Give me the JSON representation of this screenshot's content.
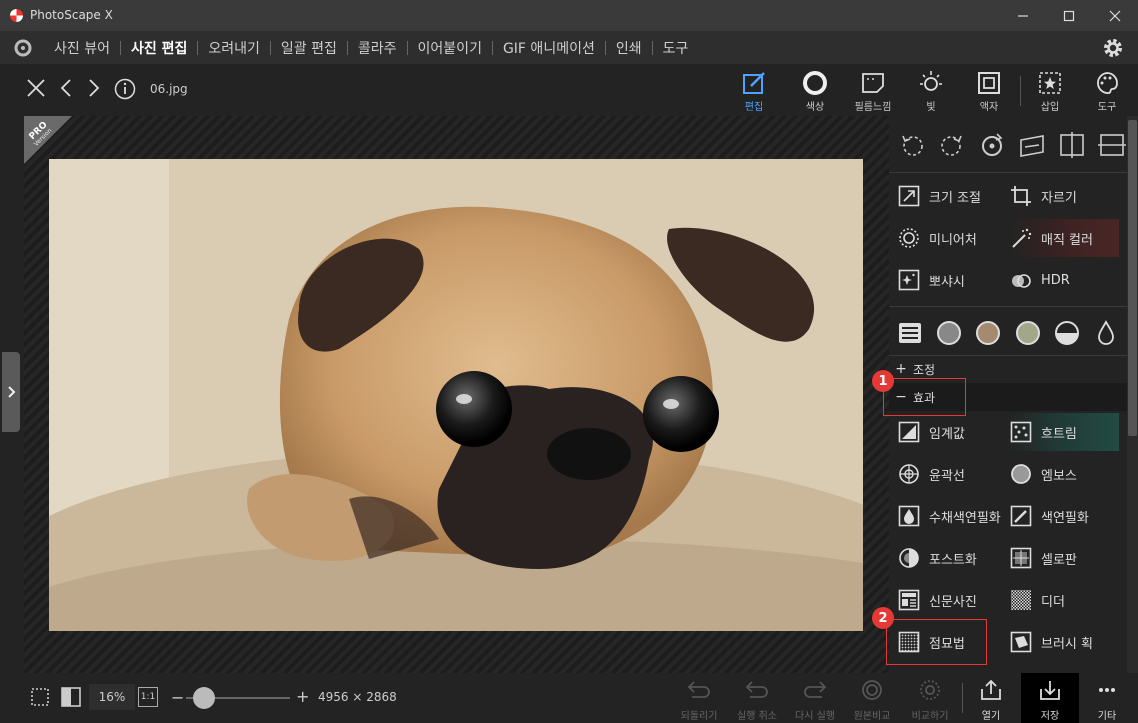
{
  "window": {
    "title": "PhotoScape X"
  },
  "menu": {
    "items": [
      {
        "label": "사진 뷰어",
        "active": false
      },
      {
        "label": "사진 편집",
        "active": true
      },
      {
        "label": "오려내기",
        "active": false
      },
      {
        "label": "일괄 편집",
        "active": false
      },
      {
        "label": "콜라주",
        "active": false
      },
      {
        "label": "이어붙이기",
        "active": false
      },
      {
        "label": "GIF 애니메이션",
        "active": false
      },
      {
        "label": "인쇄",
        "active": false
      },
      {
        "label": "도구",
        "active": false
      }
    ]
  },
  "toolbar": {
    "filename": "06.jpg",
    "tools": [
      {
        "label": "편집",
        "icon": "edit-icon",
        "active": true
      },
      {
        "label": "색상",
        "icon": "color-circle-icon"
      },
      {
        "label": "필름느낌",
        "icon": "film-icon"
      },
      {
        "label": "빛",
        "icon": "sun-icon"
      },
      {
        "label": "액자",
        "icon": "frame-icon"
      },
      {
        "label": "삽입",
        "icon": "insert-icon"
      },
      {
        "label": "도구",
        "icon": "palette-icon"
      }
    ]
  },
  "canvas": {
    "badge_main": "PRO",
    "badge_sub": "Version"
  },
  "panel": {
    "top_buttons": [
      {
        "label": "크기 조절",
        "icon": "resize-icon"
      },
      {
        "label": "자르기",
        "icon": "crop-icon"
      },
      {
        "label": "미니어처",
        "icon": "miniature-icon"
      },
      {
        "label": "매직 컬러",
        "icon": "magic-wand-icon"
      },
      {
        "label": "뽀샤시",
        "icon": "sparkle-icon"
      },
      {
        "label": "HDR",
        "icon": "hdr-icon"
      }
    ],
    "section_adjust": {
      "sign": "+",
      "label": "조정"
    },
    "section_effect": {
      "sign": "−",
      "label": "효과"
    },
    "effect_buttons": [
      {
        "label": "임계값",
        "icon": "threshold-icon"
      },
      {
        "label": "흐트림",
        "icon": "scatter-icon"
      },
      {
        "label": "윤곽선",
        "icon": "outline-icon"
      },
      {
        "label": "엠보스",
        "icon": "emboss-icon"
      },
      {
        "label": "수채색연필화",
        "icon": "watercolor-icon"
      },
      {
        "label": "색연필화",
        "icon": "pencil-icon"
      },
      {
        "label": "포스트화",
        "icon": "posterize-icon"
      },
      {
        "label": "셀로판",
        "icon": "cellophane-icon"
      },
      {
        "label": "신문사진",
        "icon": "newspaper-icon"
      },
      {
        "label": "디더",
        "icon": "dither-icon"
      },
      {
        "label": "점묘법",
        "icon": "pointillism-icon"
      },
      {
        "label": "브러시 획",
        "icon": "brush-stroke-icon"
      }
    ],
    "callouts": [
      "1",
      "2"
    ]
  },
  "bottombar": {
    "zoom": "16%",
    "one_to_one": "1:1",
    "minus": "−",
    "plus": "+",
    "zoom_level": 0.16,
    "dimensions": "4956 × 2868",
    "actions": [
      {
        "label": "되돌리기",
        "icon": "revert-icon",
        "enabled": false
      },
      {
        "label": "실행 취소",
        "icon": "undo-icon",
        "enabled": false
      },
      {
        "label": "다시 실행",
        "icon": "redo-icon",
        "enabled": false
      },
      {
        "label": "원본비교",
        "icon": "compare-original-icon",
        "enabled": false
      },
      {
        "label": "비교하기",
        "icon": "compare-icon",
        "enabled": false
      },
      {
        "label": "열기",
        "icon": "open-icon",
        "enabled": true
      },
      {
        "label": "저장",
        "icon": "save-icon",
        "enabled": true
      },
      {
        "label": "기타",
        "icon": "more-icon",
        "enabled": true
      }
    ]
  },
  "colors": {
    "accent": "#4da3ff",
    "callout": "#e53935",
    "background": "#232323"
  }
}
